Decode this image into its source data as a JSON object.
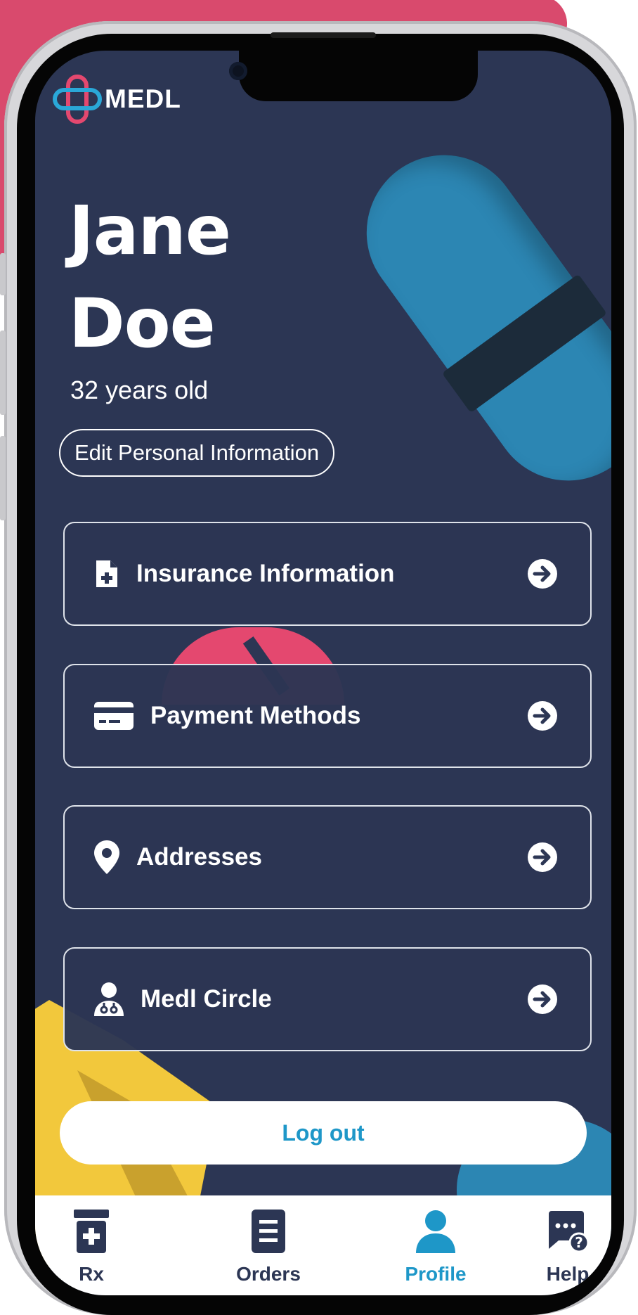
{
  "app": {
    "logo_text": "MEDL"
  },
  "profile": {
    "first_name": "Jane",
    "last_name": "Doe",
    "age_text": "32 years old",
    "edit_label": "Edit Personal Information"
  },
  "menu": [
    {
      "label": "Insurance Information",
      "icon": "file-medical-icon"
    },
    {
      "label": "Payment Methods",
      "icon": "credit-card-icon"
    },
    {
      "label": "Addresses",
      "icon": "map-pin-icon"
    },
    {
      "label": "Medl Circle",
      "icon": "user-doctor-icon"
    }
  ],
  "logout_label": "Log out",
  "tabs": [
    {
      "label": "Rx",
      "icon": "prescription-bottle-icon",
      "active": false
    },
    {
      "label": "Orders",
      "icon": "clipboard-list-icon",
      "active": false
    },
    {
      "label": "Profile",
      "icon": "user-icon",
      "active": true
    },
    {
      "label": "Help",
      "icon": "chat-help-icon",
      "active": false
    }
  ],
  "colors": {
    "background": "#2c3654",
    "accent": "#1e97c8",
    "logo_pink": "#e4486f",
    "logo_blue": "#2aa8d8"
  }
}
